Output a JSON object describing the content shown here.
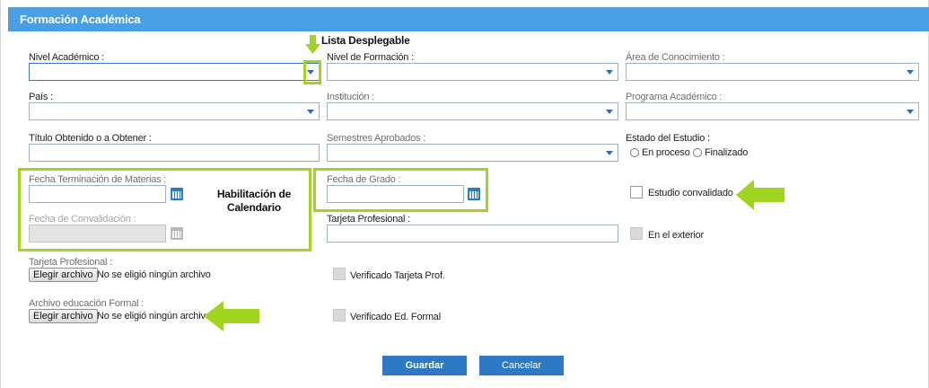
{
  "header": {
    "title": "Formación Académica"
  },
  "annotations": {
    "lista_desplegable": "Lista Desplegable",
    "habilitacion_line1": "Habilitación de",
    "habilitacion_line2": "Calendario"
  },
  "fields": {
    "nivel_academico": "Nivel Académico :",
    "nivel_formacion": "Nivel de Formación :",
    "area_conocimiento": "Área de Conocimiento :",
    "pais": "País :",
    "institucion": "Institución :",
    "programa_academico": "Programa Académico :",
    "titulo": "Título Obtenido o a Obtener :",
    "semestres": "Semestres Aprobados :",
    "estado_estudio": "Estado del Estudio :",
    "fecha_terminacion": "Fecha Terminación de Materias :",
    "fecha_grado": "Fecha de Grado :",
    "fecha_convalidacion": "Fecha de Convalidación :",
    "tarjeta_profesional_text": "Tarjeta Profesional :",
    "tarjeta_profesional_file": "Tarjeta Profesional :",
    "archivo_educacion": "Archivo educación Formal :"
  },
  "radios": {
    "en_proceso": "En proceso",
    "finalizado": "Finalizado"
  },
  "checkboxes": {
    "estudio_convalidado": "Estudio convalidado",
    "en_el_exterior": "En el exterior",
    "verificado_tarjeta": "Verificado Tarjeta Prof.",
    "verificado_ed_formal": "Verificado Ed. Formal"
  },
  "file": {
    "button_label": "Elegir archivo",
    "no_file": "No se eligió ningún archivo"
  },
  "buttons": {
    "guardar": "Guardar",
    "cancelar": "Cancelar"
  },
  "colors": {
    "header_bg": "#4a9ee2",
    "highlight": "#9fd51e",
    "button": "#2c79c4",
    "input_border": "#9fb1c8"
  },
  "icons": [
    "chevron-down-icon",
    "calendar-icon",
    "arrow-down-icon",
    "arrow-left-icon"
  ]
}
